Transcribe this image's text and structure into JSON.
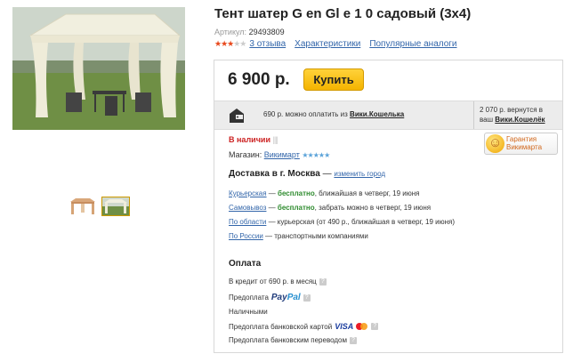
{
  "product": {
    "title": "Тент шатер G    en Gl    e 1    0 садовый (3x4)",
    "article_label": "Артикул:",
    "article": "29493809",
    "rating_stars": 3,
    "reviews_link": "3 отзыва",
    "specs_link": "Характеристики",
    "popular_link": "Популярные аналоги"
  },
  "gallery": {
    "thumbnails": [
      "tent-thumb-1",
      "tent-thumb-2"
    ]
  },
  "offer": {
    "price": "6 900 р.",
    "buy_label": "Купить",
    "wallet_prefix": "690 р. можно оплатить из",
    "wallet_link": "Вики.Кошелька",
    "cashback_line1": "2 070 р. вернутся в",
    "cashback_prefix": "ваш",
    "cashback_link": "Вики.Кошелёк",
    "stock": "В наличии",
    "stock_bars": "||||",
    "shop_label": "Магазин:",
    "shop_link": "Викимарт",
    "shop_stars": "★★★★★",
    "badge_line1": "Гарантия",
    "badge_line2": "Викимарта"
  },
  "delivery": {
    "title": "Доставка в г. Москва",
    "sep": " — ",
    "change_city": "изменить город",
    "lines": [
      {
        "link": "Курьерская",
        "dash": " — ",
        "free": "бесплатно",
        "rest": ", ближайшая в четверг, 19 июня"
      },
      {
        "link": "Самовывоз",
        "dash": " — ",
        "free": "бесплатно",
        "rest": ", забрать можно в четверг, 19 июня"
      },
      {
        "link": "По области",
        "dash": " — ",
        "free": "",
        "rest": "курьерская (от 490 р., ближайшая в четверг, 19 июня)"
      },
      {
        "link": "По России",
        "dash": " — ",
        "free": "",
        "rest": "транспортными компаниями"
      }
    ]
  },
  "payment": {
    "title": "Оплата",
    "credit": "В кредит от 690 р. в месяц",
    "prepay_paypal": "Предоплата",
    "paypal_a": "Pay",
    "paypal_b": "Pal",
    "cash": "Наличными",
    "card": "Предоплата банковской картой",
    "visa": "VISA",
    "transfer": "Предоплата банковским переводом",
    "help_glyph": "?"
  }
}
